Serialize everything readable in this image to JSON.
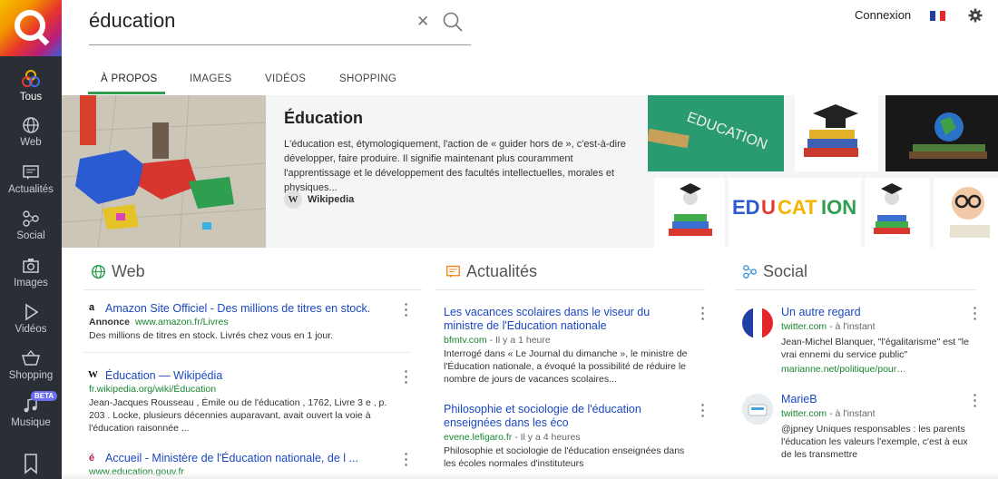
{
  "search": {
    "query": "éducation"
  },
  "header": {
    "login_label": "Connexion"
  },
  "colors": {
    "accent": "#2e9e4f",
    "link": "#1b48c2",
    "url": "#17862e",
    "sidebar_bg": "#2a2f35"
  },
  "sidebar": {
    "items": [
      {
        "label": "Tous",
        "icon": "all-results-icon"
      },
      {
        "label": "Web",
        "icon": "globe-icon"
      },
      {
        "label": "Actualités",
        "icon": "news-icon"
      },
      {
        "label": "Social",
        "icon": "social-icon"
      },
      {
        "label": "Images",
        "icon": "camera-icon"
      },
      {
        "label": "Vidéos",
        "icon": "play-icon"
      },
      {
        "label": "Shopping",
        "icon": "cart-icon"
      },
      {
        "label": "Musique",
        "icon": "music-icon",
        "badge": "BETA"
      },
      {
        "label": "",
        "icon": "bookmark-icon"
      }
    ]
  },
  "tabs": [
    "À PROPOS",
    "IMAGES",
    "VIDÉOS",
    "SHOPPING"
  ],
  "knowledge": {
    "title": "Éducation",
    "description": "L'éducation est, étymologiquement, l'action de « guider hors de », c'est-à-dire développer, faire produire. Il signifie maintenant plus couramment l'apprentissage et le développement des facultés intellectuelles, morales et physiques...",
    "source": "Wikipedia",
    "source_badge": "W"
  },
  "web": {
    "heading": "Web",
    "results": [
      {
        "title": "Amazon Site Officiel - Des millions de titres en stock.",
        "ad_label": "Annonce",
        "url": "www.amazon.fr/Livres",
        "desc": "Des millions de titres en stock. Livrés chez vous en 1 jour.",
        "favicon": "a"
      },
      {
        "title": "Éducation — Wikipédia",
        "url": "fr.wikipedia.org/wiki/Éducation",
        "desc": "Jean-Jacques Rousseau , Émile ou de l'éducation , 1762, Livre 3 e , p. 203 . Locke, plusieurs décennies auparavant, avait ouvert la voie à l'éducation raisonnée ...",
        "favicon": "W"
      },
      {
        "title": "Accueil - Ministère de l'Éducation nationale, de l ...",
        "url": "www.education.gouv.fr",
        "favicon": "é"
      }
    ]
  },
  "news": {
    "heading": "Actualités",
    "results": [
      {
        "title": "Les vacances scolaires dans le viseur du ministre de l'Education nationale",
        "source": "bfmtv.com",
        "time": "Il y a 1 heure",
        "desc": "Interrogé dans « Le Journal du dimanche », le ministre de l'Éducation nationale, a évoqué la possibilité de réduire le nombre de jours de vacances scolaires..."
      },
      {
        "title": "Philosophie et sociologie de l'éducation enseignées dans les éco",
        "source": "evene.lefigaro.fr",
        "time": "Il y a 4 heures",
        "desc": "Philosophie et sociologie de l'éducation enseignées dans les écoles normales d'instituteurs"
      }
    ]
  },
  "social": {
    "heading": "Social",
    "results": [
      {
        "title": "Un autre regard",
        "source": "twitter.com",
        "time": "à l'instant",
        "desc": "Jean-Michel Blanquer, \"l'égalitarisme\" est \"le vrai ennemi du service public\"",
        "link": "marianne.net/politique/pour…"
      },
      {
        "title": "MarieB",
        "source": "twitter.com",
        "time": "à l'instant",
        "desc": "@jpney Uniques responsables : les parents l'éducation les valeurs l'exemple, c'est à eux de les transmettre"
      }
    ]
  }
}
